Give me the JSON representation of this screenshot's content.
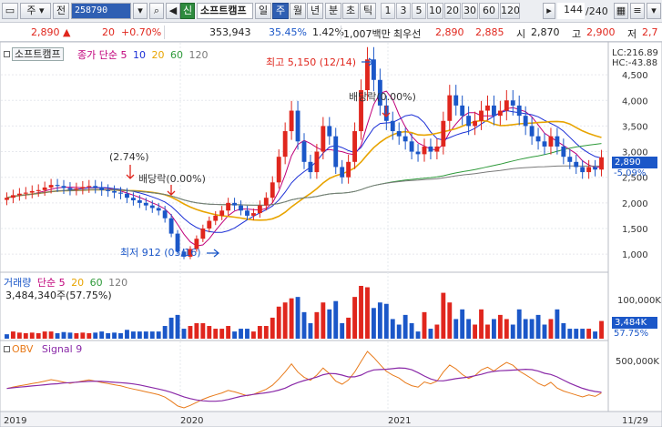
{
  "toolbar": {
    "market_type": "주",
    "jeon_label": "전",
    "code": "258790",
    "sin_label": "신",
    "stock_name": "소프트캠프",
    "periods": [
      "일",
      "주",
      "월",
      "년",
      "분",
      "초",
      "틱"
    ],
    "selected_period": "주",
    "intervals": [
      "1",
      "3",
      "5",
      "10",
      "20",
      "30",
      "60",
      "120"
    ],
    "count": "144",
    "count_total": "/240"
  },
  "quote": {
    "price": "2,890",
    "change_arrow": "▲",
    "change": "20",
    "change_rate": "+0.70%",
    "volume": "353,943",
    "turnover_rate": "35.45%",
    "ratio": "1.42%",
    "amount": "1,007백만",
    "best_bid_label": "최우선",
    "best_ask": "2,890",
    "best_bid": "2,885",
    "open_label": "시",
    "open": "2,870",
    "high_label": "고",
    "high": "2,900",
    "low_label": "저",
    "low": "2,7"
  },
  "price_panel": {
    "stock_label": "소프트캠프",
    "ma_title": "종가 단순",
    "ma_periods": [
      "5",
      "10",
      "20",
      "60",
      "120"
    ],
    "ma_colors": [
      "#c0007a",
      "#1b2fd6",
      "#e8a400",
      "#2e9a3a",
      "#7a7a7a"
    ],
    "lc_label": "LC:216.89",
    "hc_label": "HC:-43.88",
    "yticks": [
      "4,500",
      "4,000",
      "3,500",
      "3,000",
      "2,500",
      "2,000",
      "1,500",
      "1,000"
    ],
    "current_price_tag": "2,890",
    "current_pct_tag": "-5.09%",
    "annotations": {
      "high": "최고 5,150 (12/14)",
      "low": "최저 912 (03/16)",
      "dividend1_pct": "(2.74%)",
      "dividend1": "배당락(0.00%)",
      "dividend2": "배당락(0.00%)"
    },
    "colors": {
      "up": "#e0261d",
      "down": "#1b57c8",
      "accent": "#e0261d"
    }
  },
  "volume_panel": {
    "title": "거래량",
    "ma_title": "단순",
    "ma_periods": [
      "5",
      "20",
      "60",
      "120"
    ],
    "value_label": "3,484,340주(57.75%)",
    "ytick": "100,000K",
    "current_tag": "3,484K",
    "current_pct": "57.75%"
  },
  "obv_panel": {
    "title": "OBV",
    "signal_label": "Signal 9",
    "ytick": "500,000K",
    "colors": {
      "obv": "#e87a1a",
      "signal": "#8a2aa8"
    }
  },
  "dates": [
    "2019",
    "2020",
    "2021",
    "11/29"
  ],
  "chart_data": {
    "type": "candlestick",
    "period": "weekly",
    "ylim": [
      700,
      5000
    ],
    "x": [
      "2019",
      "2020",
      "2021",
      "11/29"
    ],
    "close_series": [
      2100,
      2150,
      2180,
      2200,
      2230,
      2250,
      2300,
      2350,
      2330,
      2290,
      2260,
      2280,
      2310,
      2330,
      2300,
      2250,
      2230,
      2200,
      2180,
      2100,
      2050,
      2000,
      1950,
      1900,
      1850,
      1700,
      1400,
      1050,
      950,
      1100,
      1300,
      1500,
      1650,
      1750,
      1850,
      2000,
      1950,
      1850,
      1750,
      1800,
      1950,
      2100,
      2400,
      2900,
      3400,
      3800,
      3200,
      2800,
      2600,
      3000,
      3500,
      3300,
      2700,
      2500,
      2800,
      3400,
      4200,
      4800,
      4400,
      3900,
      3600,
      3400,
      3300,
      3200,
      3000,
      2950,
      3100,
      3000,
      3100,
      3600,
      4100,
      3900,
      3700,
      3500,
      3600,
      3800,
      3900,
      3700,
      3800,
      4000,
      3900,
      3700,
      3500,
      3300,
      3200,
      3100,
      3300,
      3100,
      2900,
      2800,
      2700,
      2600,
      2700,
      2650,
      2890
    ],
    "events": [
      {
        "label": "최고",
        "value": 5150,
        "date": "12/14"
      },
      {
        "label": "최저",
        "value": 912,
        "date": "03/16"
      },
      {
        "label": "배당락",
        "value": "(2.74%)"
      },
      {
        "label": "배당락",
        "value": "(0.00%)"
      }
    ],
    "volume_max": 100000,
    "obv_max": 500000
  }
}
